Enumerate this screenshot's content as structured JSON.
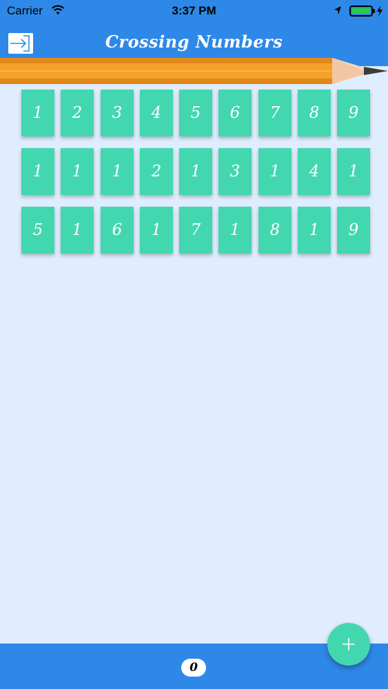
{
  "status_bar": {
    "carrier": "Carrier",
    "time": "3:37 PM",
    "icons": [
      "wifi-icon",
      "location-arrow-icon",
      "battery-icon",
      "charging-bolt-icon"
    ]
  },
  "nav": {
    "title": "Crossing Numbers",
    "exit_icon": "exit-arrow-icon"
  },
  "grid": {
    "rows": [
      [
        "1",
        "2",
        "3",
        "4",
        "5",
        "6",
        "7",
        "8",
        "9"
      ],
      [
        "1",
        "1",
        "1",
        "2",
        "1",
        "3",
        "1",
        "4",
        "1"
      ],
      [
        "5",
        "1",
        "6",
        "1",
        "7",
        "1",
        "8",
        "1",
        "9"
      ]
    ]
  },
  "footer": {
    "score": "0",
    "add_icon": "plus-icon"
  },
  "colors": {
    "bar": "#2E88E8",
    "tile": "#43D7B0",
    "background": "#DFEDFE",
    "pencil": "#F4A12A"
  }
}
